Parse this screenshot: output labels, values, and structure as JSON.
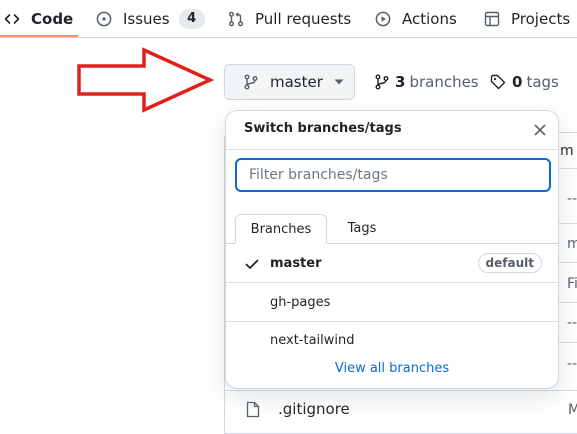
{
  "repo_nav": {
    "tabs": [
      {
        "label": "Code",
        "icon": "code-icon",
        "active": true
      },
      {
        "label": "Issues",
        "icon": "issue-opened-icon",
        "count": "4"
      },
      {
        "label": "Pull requests",
        "icon": "git-pull-request-icon"
      },
      {
        "label": "Actions",
        "icon": "play-icon"
      },
      {
        "label": "Projects",
        "icon": "table-icon"
      }
    ]
  },
  "branch_bar": {
    "branch_button_label": "master",
    "branches_count": "3",
    "branches_label": "branches",
    "tags_count": "0",
    "tags_label": "tags"
  },
  "annotation": {
    "arrow_color": "#e0201b"
  },
  "dropdown": {
    "title": "Switch branches/tags",
    "filter_placeholder": "Filter branches/tags",
    "filter_value": "",
    "tabs": [
      "Branches",
      "Tags"
    ],
    "branches": [
      {
        "name": "master",
        "selected": true,
        "badge": "default"
      },
      {
        "name": "gh-pages"
      },
      {
        "name": "next-tailwind"
      }
    ],
    "view_all_label": "View all branches"
  },
  "file_list": {
    "header_fragment": "m M",
    "row_fragments": [
      "--",
      "m",
      "Fi",
      "--",
      "--"
    ],
    "visible_file": ".gitignore",
    "visible_file_right_fragment": "M"
  },
  "colors": {
    "accent_blue": "#0969da",
    "tab_underline": "#fd8c73",
    "border": "#d0d7de"
  }
}
